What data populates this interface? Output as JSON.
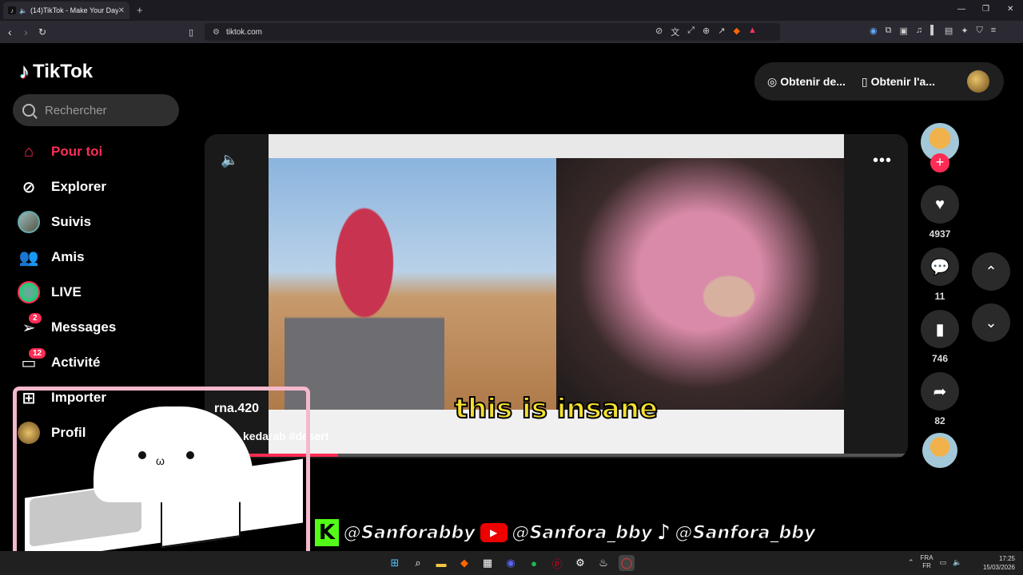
{
  "browser": {
    "tab_title": "(14)TikTok - Make Your Day",
    "url": "tiktok.com",
    "new_tab": "+"
  },
  "sidebar": {
    "logo": "TikTok",
    "search_placeholder": "Rechercher",
    "items": [
      {
        "label": "Pour toi",
        "icon": "home-icon",
        "active": true
      },
      {
        "label": "Explorer",
        "icon": "compass-icon"
      },
      {
        "label": "Suivis",
        "icon": "avatar-icon"
      },
      {
        "label": "Amis",
        "icon": "friends-icon"
      },
      {
        "label": "LIVE",
        "icon": "live-icon"
      },
      {
        "label": "Messages",
        "icon": "paper-plane-icon",
        "badge": "2"
      },
      {
        "label": "Activité",
        "icon": "inbox-icon",
        "badge": "12"
      },
      {
        "label": "Importer",
        "icon": "plus-square-icon"
      },
      {
        "label": "Profil",
        "icon": "profile-avatar-icon"
      }
    ]
  },
  "topbar": {
    "get_coins": "Obtenir de...",
    "get_app": "Obtenir l'a..."
  },
  "video": {
    "caption": "this is insane",
    "username": "rna.420",
    "tags": "kedarab #desert",
    "progress": 0.19
  },
  "actions": {
    "likes": "4937",
    "comments": "11",
    "saves": "746",
    "shares": "82"
  },
  "overlay": {
    "socials": [
      "@Sanforabby",
      "@Sanfora_bby",
      "@Sanfora_bby"
    ]
  },
  "taskbar": {
    "lang_line1": "FRA",
    "lang_line2": "FR",
    "time": "17:25",
    "date": "15/03/2026"
  },
  "colors": {
    "accent": "#fe2c55",
    "caption_yellow": "#f5e12f",
    "overlay_border": "#f5b8cc"
  }
}
